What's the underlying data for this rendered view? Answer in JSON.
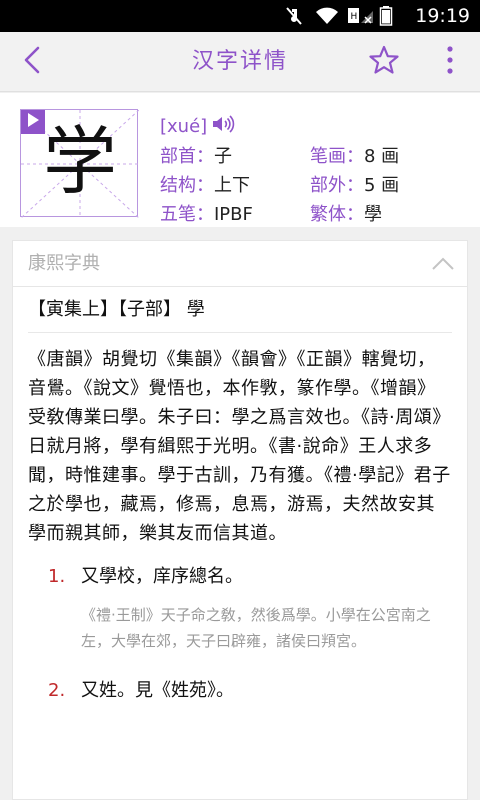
{
  "status_bar": {
    "time": "19:19",
    "icons": [
      "mute-icon",
      "wifi-icon",
      "sim-no-signal-icon",
      "battery-icon"
    ]
  },
  "app_bar": {
    "title": "汉字详情",
    "back_icon": "chevron-left-icon",
    "favorite_icon": "star-outline-icon",
    "more_icon": "more-vert-icon",
    "accent_color": "#8e53c9"
  },
  "character": {
    "glyph": "学",
    "pinyin": "[xué]",
    "play_icon": "play-icon",
    "speaker_icon": "speaker-icon",
    "fields": [
      [
        {
          "label": "部首：",
          "value": "子"
        },
        {
          "label": "笔画：",
          "value": "8 画"
        }
      ],
      [
        {
          "label": "结构：",
          "value": "上下"
        },
        {
          "label": "部外：",
          "value": "5 画"
        }
      ],
      [
        {
          "label": "五笔：",
          "value": "IPBF"
        },
        {
          "label": "繁体：",
          "value": "學"
        }
      ]
    ]
  },
  "kangxi": {
    "section_title": "康熙字典",
    "collapse_icon": "chevron-up-icon",
    "heading": "【寅集上】【子部】 學",
    "paragraph": "《唐韻》胡覺切《集韻》《韻會》《正韻》轄覺切，音鷽。《說文》覺悟也，本作斆，篆作學。《增韻》受敎傳業曰學。朱子曰：學之爲言效也。《詩·周頌》日就月將，學有緝熙于光明。《書·說命》王人求多聞，時惟建事。學于古訓，乃有獲。《禮·學記》君子之於學也，藏焉，修焉，息焉，游焉，夫然故安其學而親其師，樂其友而信其道。",
    "senses": [
      {
        "number": "1.",
        "text": "又學校，庠序總名。",
        "quote": "《禮·王制》天子命之敎，然後爲學。小學在公宮南之左，大學在郊，天子曰辟雍，諸侯曰頖宮。"
      },
      {
        "number": "2.",
        "text": "又姓。見《姓苑》。",
        "quote": ""
      }
    ]
  }
}
